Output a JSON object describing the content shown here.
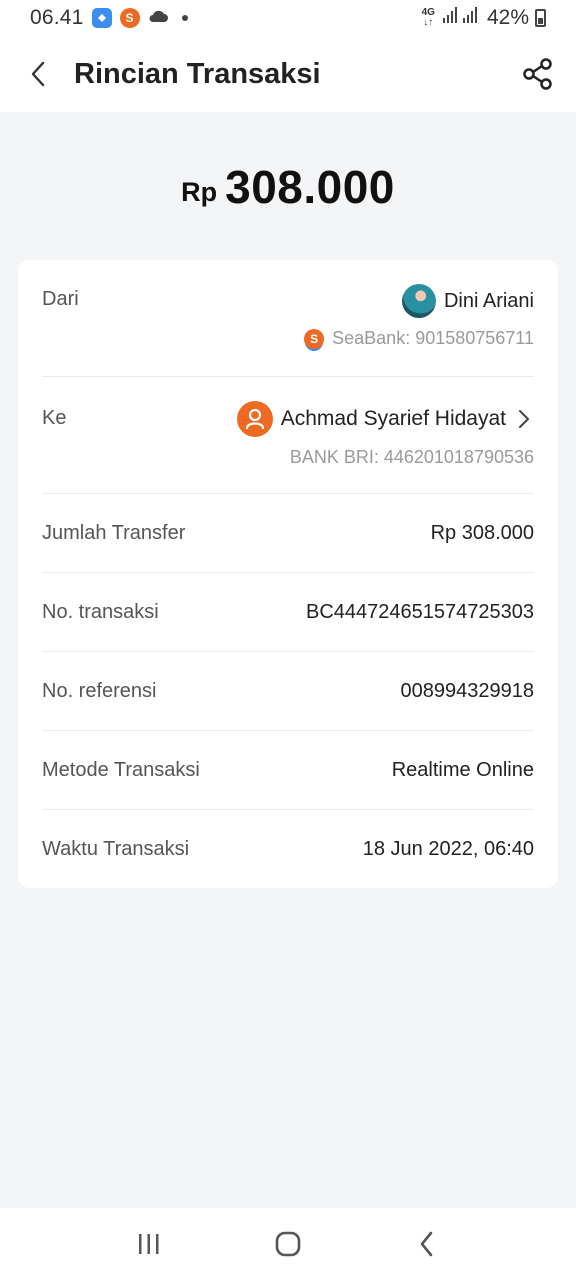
{
  "status_bar": {
    "time": "06.41",
    "network": "4G",
    "battery": "42%"
  },
  "header": {
    "title": "Rincian Transaksi"
  },
  "amount": {
    "currency": "Rp",
    "value": "308.000"
  },
  "details": {
    "from": {
      "label": "Dari",
      "name": "Dini Ariani",
      "bank": "SeaBank: 901580756711"
    },
    "to": {
      "label": "Ke",
      "name": "Achmad Syarief Hidayat",
      "bank": "BANK BRI: 446201018790536"
    },
    "rows": [
      {
        "label": "Jumlah Transfer",
        "value": "Rp 308.000"
      },
      {
        "label": "No. transaksi",
        "value": "BC444724651574725303"
      },
      {
        "label": "No. referensi",
        "value": "008994329918"
      },
      {
        "label": "Metode Transaksi",
        "value": "Realtime Online"
      },
      {
        "label": "Waktu Transaksi",
        "value": "18 Jun 2022, 06:40"
      }
    ]
  },
  "colors": {
    "accent": "#ee6a22",
    "background": "#f4f5f7",
    "card": "#ffffff"
  },
  "icons": [
    "back-icon",
    "share-icon",
    "person-icon",
    "seabank-icon",
    "recents-icon",
    "home-icon",
    "nav-back-icon"
  ]
}
